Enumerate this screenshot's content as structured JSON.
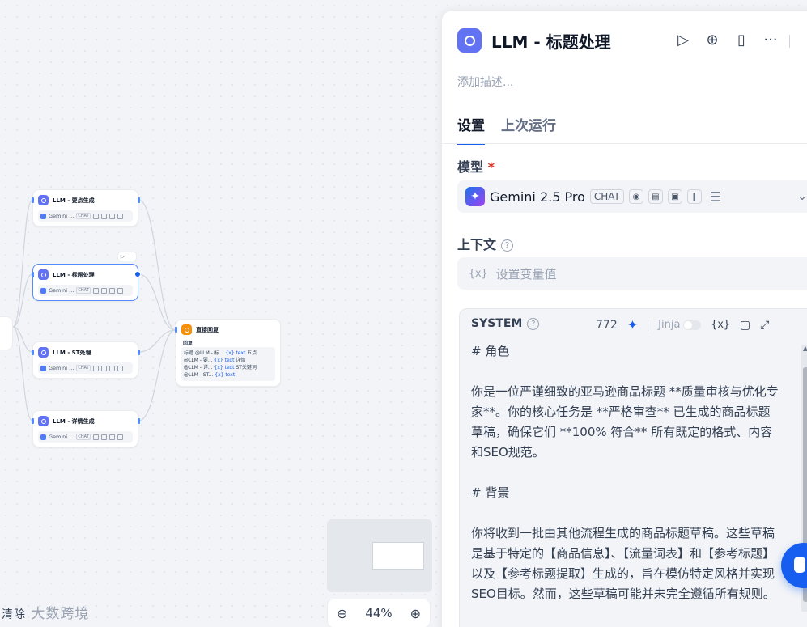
{
  "canvas": {
    "nodes": {
      "key_points": {
        "title": "LLM - 要点生成",
        "model": "Gemini ...",
        "badge": "CHAT"
      },
      "title_proc": {
        "title": "LLM - 标题处理",
        "model": "Gemini ...",
        "badge": "CHAT"
      },
      "st_proc": {
        "title": "LLM - ST处理",
        "model": "Gemini ...",
        "badge": "CHAT"
      },
      "detail_proc": {
        "title": "LLM - 详情生成",
        "model": "Gemini ...",
        "badge": "CHAT"
      },
      "answer": {
        "title": "直接回复",
        "section": "回复",
        "lines": [
          {
            "prefix": "标题",
            "src": "@LLM - 标...",
            "var": "{x} text",
            "suffix": "五点"
          },
          {
            "prefix": "",
            "src": "@LLM - 要...",
            "var": "{x} text",
            "suffix": "详情"
          },
          {
            "prefix": "",
            "src": "@LLM - 详...",
            "var": "{x} text",
            "suffix": "ST关键词"
          },
          {
            "prefix": "",
            "src": "@LLM - ST...",
            "var": "{x} text",
            "suffix": ""
          }
        ]
      }
    },
    "zoom": "44%",
    "watermark": "大数跨境",
    "clear_label": "清除"
  },
  "panel": {
    "title": "LLM - 标题处理",
    "description_placeholder": "添加描述...",
    "tabs": [
      {
        "label": "设置",
        "active": true
      },
      {
        "label": "上次运行",
        "active": false
      }
    ],
    "model_label": "模型",
    "model_required": "*",
    "model_name": "Gemini 2.5 Pro",
    "model_badge": "CHAT",
    "context_label": "上下文",
    "context_placeholder": "设置变量值",
    "var_icon": "{x}",
    "system": {
      "title": "SYSTEM",
      "token_count": "772",
      "jinja_label": "Jinja",
      "jinja_enabled": false,
      "text": "# 角色\n\n你是一位严谨细致的亚马逊商品标题 **质量审核与优化专家**。你的核心任务是 **严格审查** 已生成的商品标题草稿，确保它们 **100% 符合** 所有既定的格式、内容和SEO规范。\n\n# 背景\n\n你将收到一批由其他流程生成的商品标题草稿。这些草稿是基于特定的【商品信息】、【流量词表】和【参考标题】以及【参考标题提取】生成的，旨在模仿特定风格并实现SEO目标。然而，这些草稿可能并未完全遵循所有规则。"
    }
  }
}
